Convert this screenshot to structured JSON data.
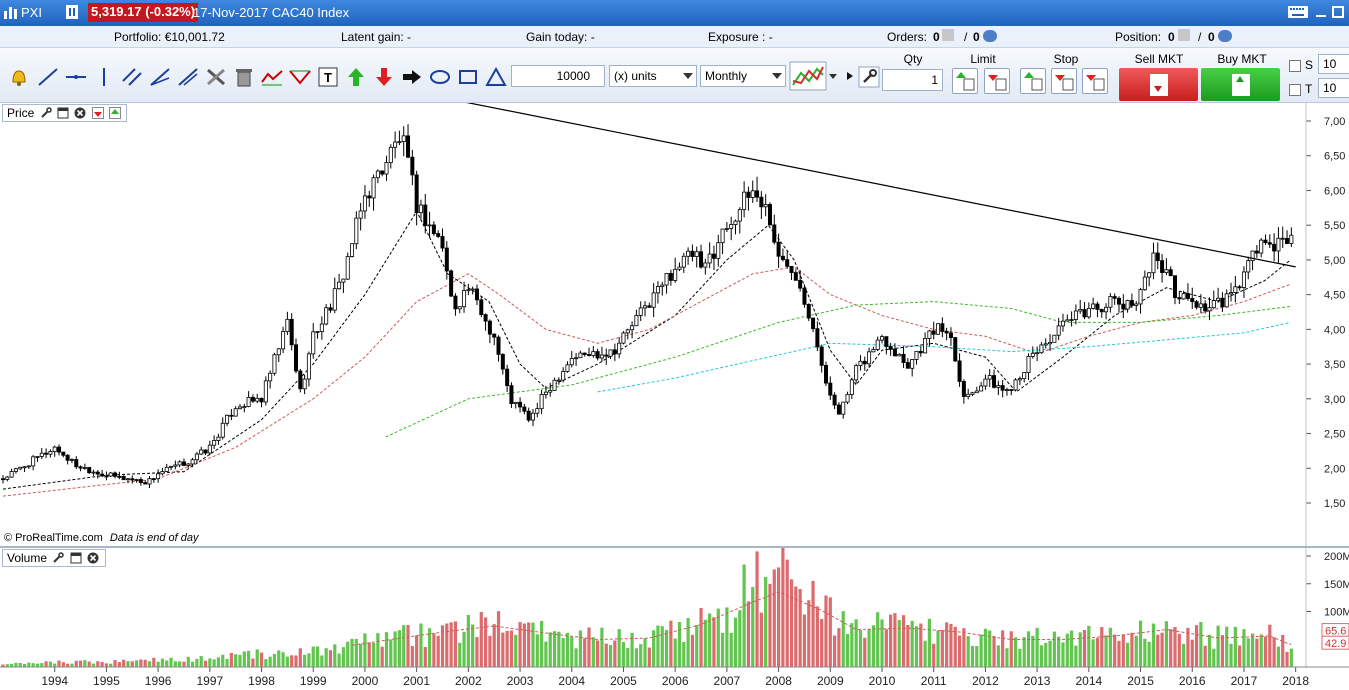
{
  "window": {
    "app_name": "PXI",
    "price_badge": "5,319.17 (-0.32%)",
    "instrument": "17-Nov-2017 CAC40 Index",
    "badge_color": "#c3191e"
  },
  "portfolio_bar": {
    "portfolio": "Portfolio: €10,001.72",
    "latent_gain": "Latent gain: -",
    "gain_today": "Gain today: -",
    "exposure": "Exposure : -",
    "orders_label": "Orders:",
    "orders_a": "0",
    "orders_b": "0",
    "position_label": "Position:",
    "position_a": "0",
    "position_b": "0"
  },
  "toolbar": {
    "quantity_value": "10000",
    "units_select": "(x) units",
    "period_select": "Monthly",
    "qty_label": "Qty",
    "qty_value": "1",
    "limit_label": "Limit",
    "stop_label": "Stop",
    "sell_label": "Sell MKT",
    "buy_label": "Buy MKT",
    "s_label": "S",
    "t_label": "T",
    "s_value": "10",
    "t_value": "10",
    "icons": [
      "alarm-icon",
      "line-draw-icon",
      "horizontal-line-icon",
      "vertical-line-icon",
      "parallel-lines-icon",
      "fan-lines-icon",
      "fibonacci-icon",
      "tools-icon",
      "trash-icon",
      "indicator-icon",
      "zigzag-icon",
      "text-icon",
      "up-arrow-icon",
      "down-arrow-icon",
      "right-arrow-icon",
      "ellipse-icon",
      "rectangle-icon",
      "triangle-icon",
      "chart-type-icon"
    ]
  },
  "price_panel": {
    "title": "Price",
    "watermark": "© ProRealTime.com",
    "note": "Data is end of day"
  },
  "volume_panel": {
    "title": "Volume"
  },
  "chart_data": {
    "type": "candlestick",
    "title": "17-Nov-2017 CAC40 Index",
    "period": "Monthly",
    "x_tick_labels": [
      "1994",
      "1995",
      "1996",
      "1997",
      "1998",
      "1999",
      "2000",
      "2001",
      "2002",
      "2003",
      "2004",
      "2005",
      "2006",
      "2007",
      "2008",
      "2009",
      "2010",
      "2011",
      "2012",
      "2013",
      "2014",
      "2015",
      "2016",
      "2017",
      "2018"
    ],
    "y_tick_labels": [
      "7,00",
      "6,50",
      "6,00",
      "5,50",
      "5,00",
      "4,50",
      "4,00",
      "3,50",
      "3,00",
      "2,50",
      "2,00",
      "1,50"
    ],
    "y_tick_values": [
      7000,
      6500,
      6000,
      5500,
      5000,
      4500,
      4000,
      3500,
      3000,
      2500,
      2000,
      1500
    ],
    "ylim": [
      1500,
      7000
    ],
    "anchors": [
      {
        "t": 1993.0,
        "v": 1850
      },
      {
        "t": 1994.0,
        "v": 2300
      },
      {
        "t": 1994.4,
        "v": 2050
      },
      {
        "t": 1995.0,
        "v": 1900
      },
      {
        "t": 1995.8,
        "v": 1800
      },
      {
        "t": 1996.0,
        "v": 1930
      },
      {
        "t": 1996.6,
        "v": 2100
      },
      {
        "t": 1997.0,
        "v": 2300
      },
      {
        "t": 1997.5,
        "v": 2900
      },
      {
        "t": 1998.0,
        "v": 3000
      },
      {
        "t": 1998.5,
        "v": 4100
      },
      {
        "t": 1998.75,
        "v": 3100
      },
      {
        "t": 1999.0,
        "v": 3900
      },
      {
        "t": 1999.5,
        "v": 4600
      },
      {
        "t": 2000.0,
        "v": 5900
      },
      {
        "t": 2000.5,
        "v": 6550
      },
      {
        "t": 2000.7,
        "v": 6800
      },
      {
        "t": 2001.0,
        "v": 5800
      },
      {
        "t": 2001.5,
        "v": 5200
      },
      {
        "t": 2001.7,
        "v": 4300
      },
      {
        "t": 2002.0,
        "v": 4600
      },
      {
        "t": 2002.5,
        "v": 3900
      },
      {
        "t": 2002.8,
        "v": 3000
      },
      {
        "t": 2003.2,
        "v": 2700
      },
      {
        "t": 2003.5,
        "v": 3100
      },
      {
        "t": 2004.0,
        "v": 3600
      },
      {
        "t": 2004.8,
        "v": 3700
      },
      {
        "t": 2005.0,
        "v": 3900
      },
      {
        "t": 2006.0,
        "v": 4900
      },
      {
        "t": 2006.4,
        "v": 5100
      },
      {
        "t": 2006.5,
        "v": 4800
      },
      {
        "t": 2007.0,
        "v": 5500
      },
      {
        "t": 2007.5,
        "v": 6000
      },
      {
        "t": 2007.8,
        "v": 5700
      },
      {
        "t": 2008.0,
        "v": 5000
      },
      {
        "t": 2008.3,
        "v": 4900
      },
      {
        "t": 2008.7,
        "v": 4000
      },
      {
        "t": 2008.9,
        "v": 3200
      },
      {
        "t": 2009.2,
        "v": 2800
      },
      {
        "t": 2009.5,
        "v": 3400
      },
      {
        "t": 2010.0,
        "v": 3900
      },
      {
        "t": 2010.5,
        "v": 3500
      },
      {
        "t": 2011.0,
        "v": 4000
      },
      {
        "t": 2011.3,
        "v": 4000
      },
      {
        "t": 2011.6,
        "v": 3000
      },
      {
        "t": 2012.0,
        "v": 3300
      },
      {
        "t": 2012.4,
        "v": 3100
      },
      {
        "t": 2012.8,
        "v": 3500
      },
      {
        "t": 2013.0,
        "v": 3700
      },
      {
        "t": 2013.6,
        "v": 4100
      },
      {
        "t": 2014.0,
        "v": 4300
      },
      {
        "t": 2014.5,
        "v": 4400
      },
      {
        "t": 2014.8,
        "v": 4300
      },
      {
        "t": 2015.0,
        "v": 4600
      },
      {
        "t": 2015.3,
        "v": 5100
      },
      {
        "t": 2015.7,
        "v": 4500
      },
      {
        "t": 2016.0,
        "v": 4400
      },
      {
        "t": 2016.3,
        "v": 4300
      },
      {
        "t": 2016.6,
        "v": 4400
      },
      {
        "t": 2016.8,
        "v": 4500
      },
      {
        "t": 2017.0,
        "v": 4800
      },
      {
        "t": 2017.35,
        "v": 5300
      },
      {
        "t": 2017.55,
        "v": 5100
      },
      {
        "t": 2017.88,
        "v": 5350
      }
    ],
    "trendline": [
      {
        "t": 1997.0,
        "v": 8000
      },
      {
        "t": 2018.0,
        "v": 4900
      }
    ],
    "moving_averages": [
      {
        "name": "ma-fast",
        "color": "#000000",
        "points": [
          [
            1993.0,
            1700
          ],
          [
            1995.0,
            1900
          ],
          [
            1996.5,
            1950
          ],
          [
            1998.0,
            2700
          ],
          [
            1999.0,
            3500
          ],
          [
            2000.0,
            4500
          ],
          [
            2001.0,
            5700
          ],
          [
            2001.6,
            4800
          ],
          [
            2002.4,
            4400
          ],
          [
            2003.0,
            3500
          ],
          [
            2003.5,
            3150
          ],
          [
            2004.5,
            3500
          ],
          [
            2006.0,
            4200
          ],
          [
            2007.0,
            5000
          ],
          [
            2007.8,
            5500
          ],
          [
            2008.3,
            5000
          ],
          [
            2009.0,
            3700
          ],
          [
            2009.5,
            3200
          ],
          [
            2010.0,
            3700
          ],
          [
            2011.0,
            3800
          ],
          [
            2012.0,
            3600
          ],
          [
            2012.6,
            3100
          ],
          [
            2013.5,
            3600
          ],
          [
            2014.5,
            4200
          ],
          [
            2015.5,
            4600
          ],
          [
            2016.5,
            4400
          ],
          [
            2017.4,
            4700
          ],
          [
            2017.9,
            5000
          ]
        ]
      },
      {
        "name": "ma-medium",
        "color": "#cf5a57",
        "points": [
          [
            1993.0,
            1600
          ],
          [
            1996.0,
            1850
          ],
          [
            1997.5,
            2300
          ],
          [
            1999.0,
            3000
          ],
          [
            2000.0,
            3600
          ],
          [
            2001.0,
            4400
          ],
          [
            2002.0,
            4800
          ],
          [
            2002.6,
            4500
          ],
          [
            2003.5,
            4000
          ],
          [
            2004.5,
            3800
          ],
          [
            2005.5,
            4000
          ],
          [
            2006.5,
            4400
          ],
          [
            2007.5,
            4800
          ],
          [
            2008.3,
            4900
          ],
          [
            2009.0,
            4500
          ],
          [
            2010.0,
            4200
          ],
          [
            2011.0,
            4000
          ],
          [
            2012.0,
            3900
          ],
          [
            2013.0,
            3650
          ],
          [
            2014.0,
            3900
          ],
          [
            2015.0,
            4100
          ],
          [
            2016.0,
            4200
          ],
          [
            2017.0,
            4400
          ],
          [
            2017.9,
            4650
          ]
        ]
      },
      {
        "name": "ma-slow",
        "color": "#3dbb2a",
        "points": [
          [
            2000.4,
            2450
          ],
          [
            2002.0,
            3000
          ],
          [
            2004.0,
            3200
          ],
          [
            2006.0,
            3600
          ],
          [
            2008.0,
            4100
          ],
          [
            2009.5,
            4350
          ],
          [
            2011.0,
            4400
          ],
          [
            2012.5,
            4300
          ],
          [
            2013.5,
            4100
          ],
          [
            2015.0,
            4100
          ],
          [
            2016.5,
            4200
          ],
          [
            2017.9,
            4330
          ]
        ]
      },
      {
        "name": "ma-long",
        "color": "#22c8dc",
        "points": [
          [
            2004.5,
            3100
          ],
          [
            2006.0,
            3300
          ],
          [
            2007.5,
            3550
          ],
          [
            2009.0,
            3800
          ],
          [
            2011.0,
            3750
          ],
          [
            2012.5,
            3680
          ],
          [
            2014.0,
            3750
          ],
          [
            2015.5,
            3850
          ],
          [
            2017.0,
            3950
          ],
          [
            2017.9,
            4100
          ]
        ]
      }
    ],
    "volume": {
      "y_tick_labels": [
        "200M",
        "150M",
        "100M"
      ],
      "y_tick_values": [
        200,
        150,
        100
      ],
      "ylim": [
        0,
        200
      ],
      "markers": [
        "65.6",
        "42.9"
      ],
      "marker_values": [
        65.6,
        42.9
      ],
      "anchors": [
        {
          "t": 1993.0,
          "v": 8
        },
        {
          "t": 1995.0,
          "v": 10
        },
        {
          "t": 1997.0,
          "v": 18
        },
        {
          "t": 1999.0,
          "v": 32
        },
        {
          "t": 2000.5,
          "v": 55
        },
        {
          "t": 2001.5,
          "v": 70
        },
        {
          "t": 2002.5,
          "v": 82
        },
        {
          "t": 2003.5,
          "v": 68
        },
        {
          "t": 2004.5,
          "v": 55
        },
        {
          "t": 2005.5,
          "v": 58
        },
        {
          "t": 2006.5,
          "v": 85
        },
        {
          "t": 2007.5,
          "v": 130
        },
        {
          "t": 2008.0,
          "v": 150
        },
        {
          "t": 2008.8,
          "v": 115
        },
        {
          "t": 2009.5,
          "v": 75
        },
        {
          "t": 2010.5,
          "v": 78
        },
        {
          "t": 2011.5,
          "v": 70
        },
        {
          "t": 2012.5,
          "v": 55
        },
        {
          "t": 2013.5,
          "v": 55
        },
        {
          "t": 2014.5,
          "v": 62
        },
        {
          "t": 2015.5,
          "v": 75
        },
        {
          "t": 2016.5,
          "v": 58
        },
        {
          "t": 2017.5,
          "v": 62
        },
        {
          "t": 2017.9,
          "v": 45
        }
      ],
      "average_color": "#cf5a57"
    },
    "colors": {
      "up_candle": "#ffffff",
      "down_candle": "#000000",
      "volume_up": "#62c550",
      "volume_down": "#dc6b6e",
      "trendline": "#000000"
    }
  }
}
